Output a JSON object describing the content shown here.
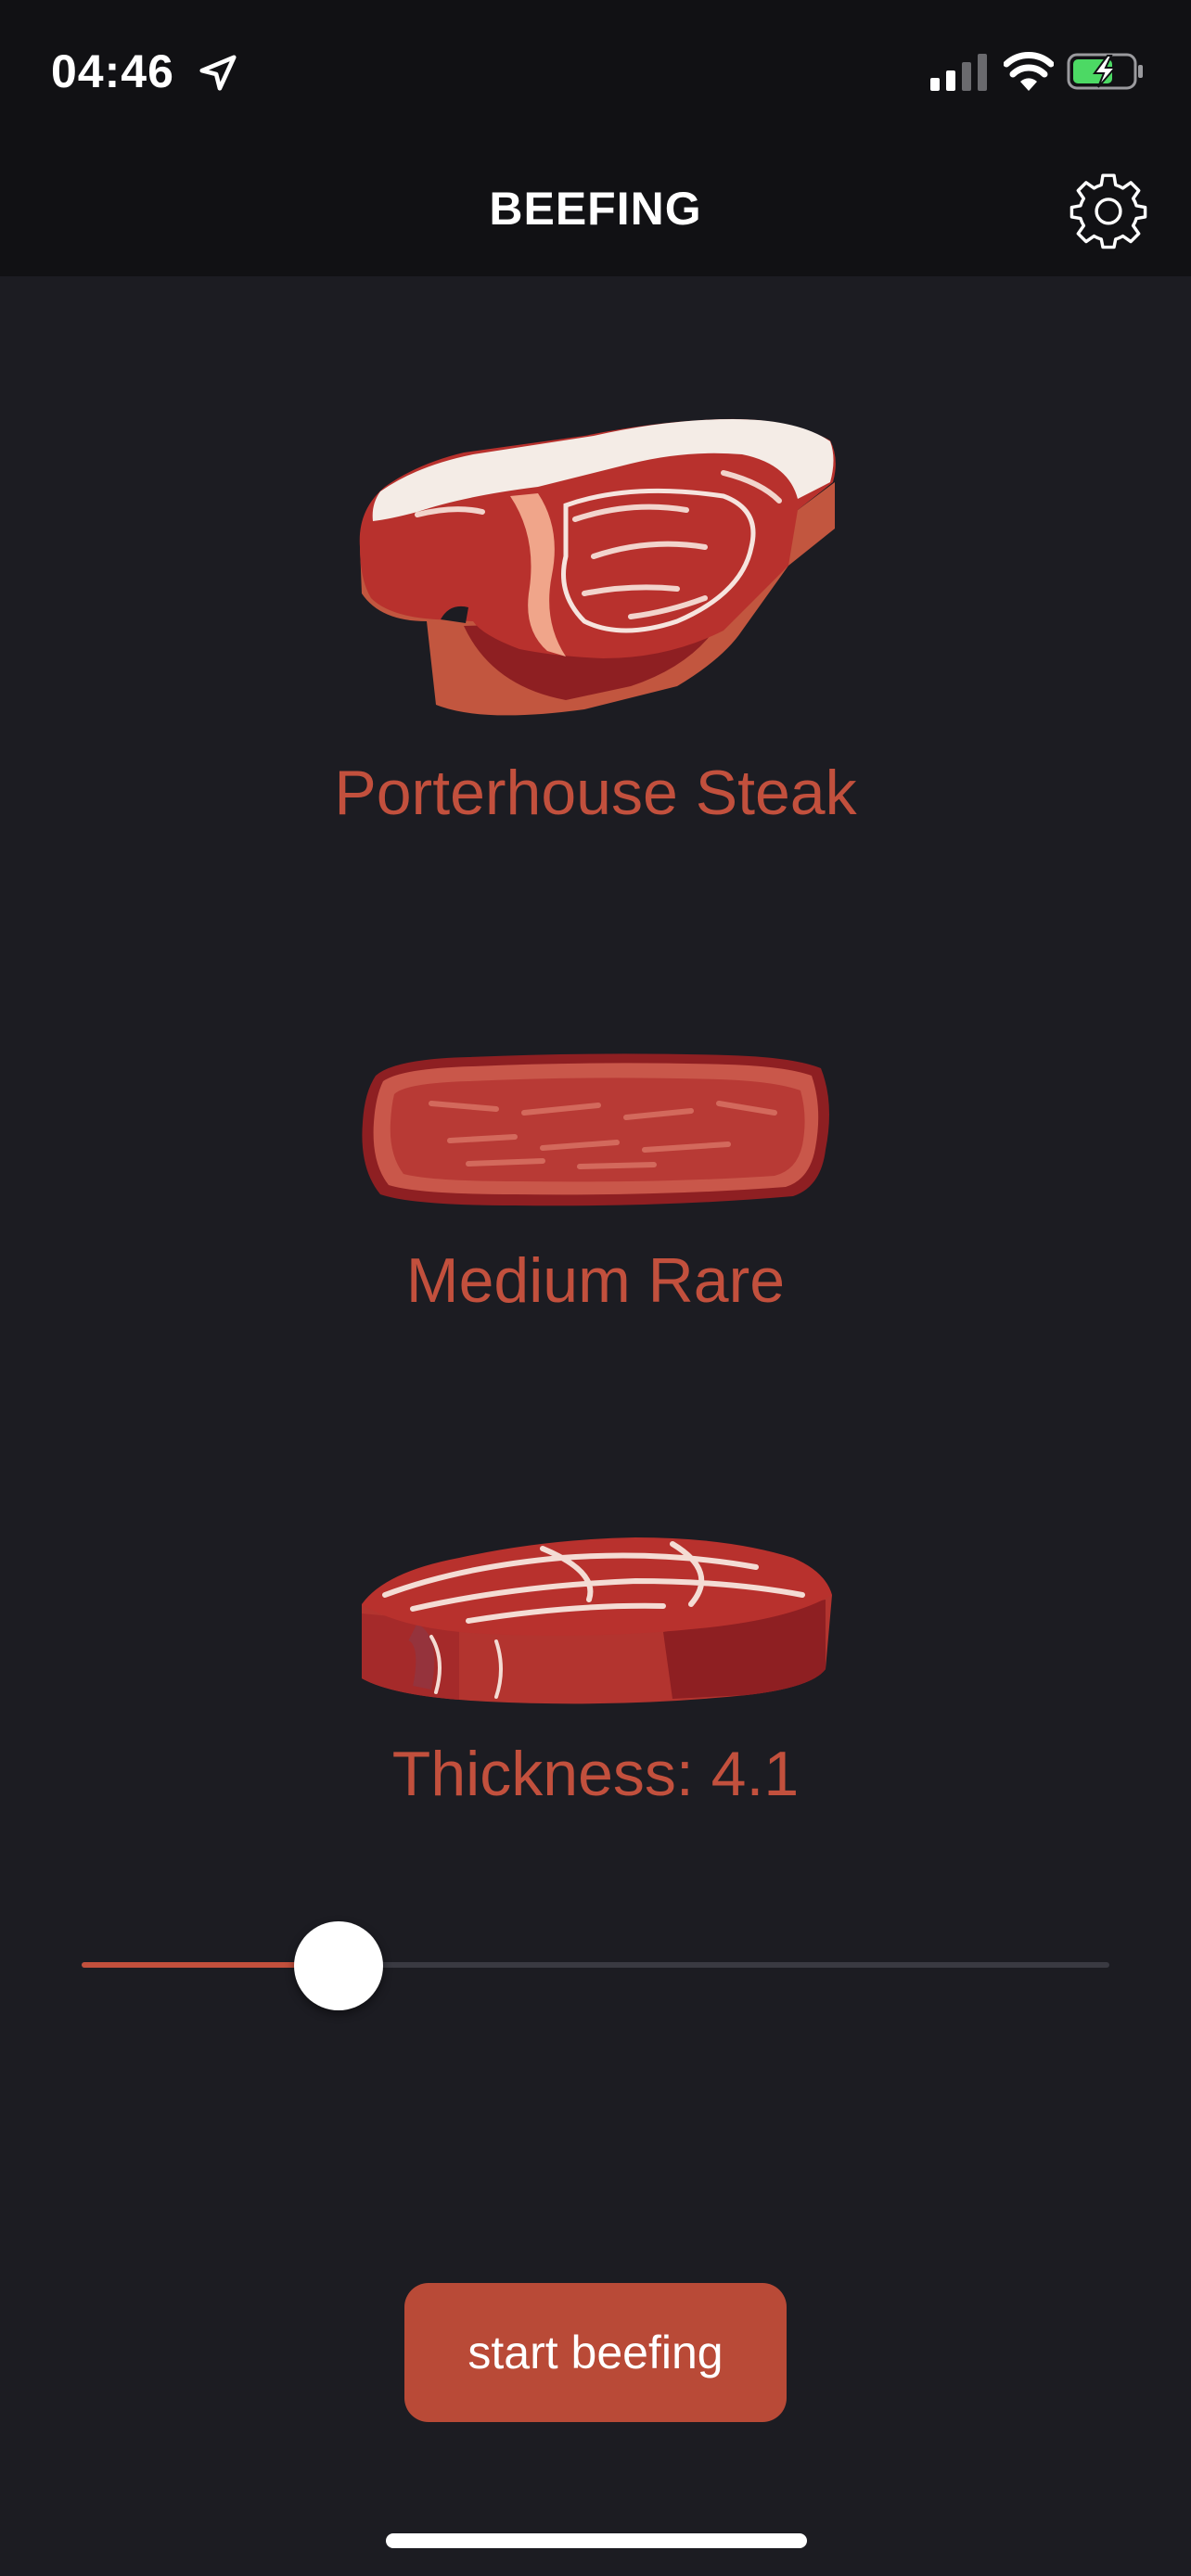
{
  "status_bar": {
    "time": "04:46"
  },
  "nav": {
    "title": "BEEFING",
    "settings_icon": "gear-icon"
  },
  "cut": {
    "label": "Porterhouse Steak",
    "image": "porterhouse-steak-illustration"
  },
  "doneness": {
    "label": "Medium Rare",
    "image": "medium-rare-steak-illustration"
  },
  "thickness": {
    "label": "Thickness: 4.1",
    "image": "steak-thickness-illustration",
    "slider_fraction": 0.25
  },
  "actions": {
    "start_label": "start beefing"
  },
  "colors": {
    "background": "#1c1c22",
    "bar": "#111114",
    "accent": "#c2503d",
    "button": "#b94a37"
  }
}
